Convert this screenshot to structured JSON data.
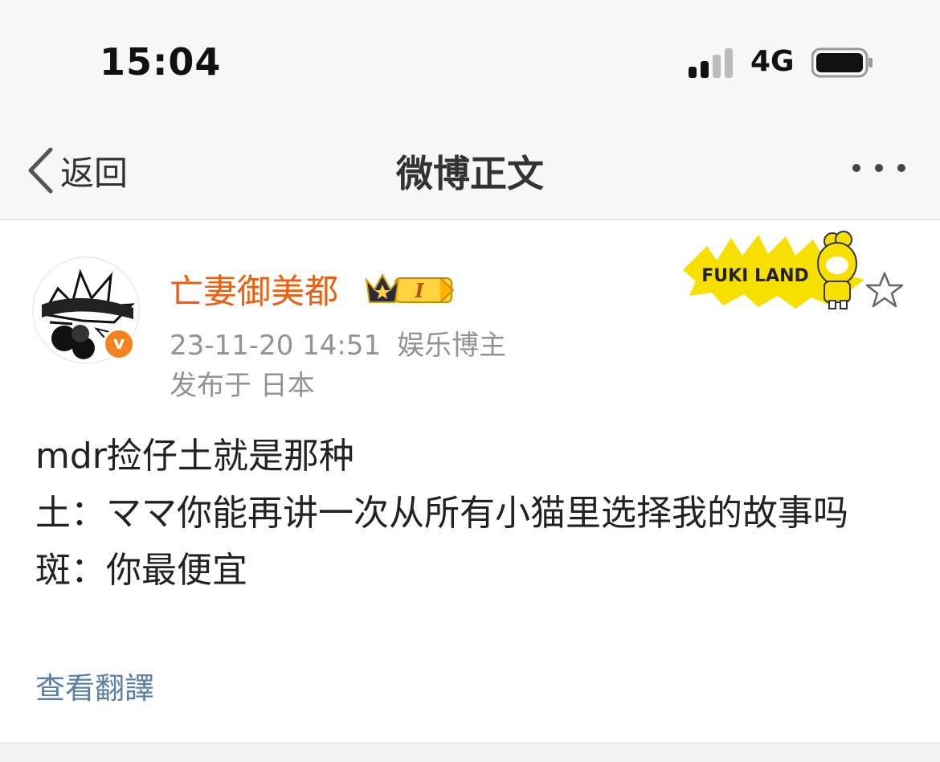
{
  "status_bar": {
    "time": "15:04",
    "network": "4G"
  },
  "nav": {
    "back_label": "返回",
    "title": "微博正文"
  },
  "post": {
    "username": "亡妻御美都",
    "badge_level": "I",
    "timestamp": "23-11-20 14:51",
    "user_label": "娱乐博主",
    "location": "发布于 日本",
    "banner_text": "FUKI LAND",
    "verified_mark": "v",
    "content_lines": [
      "mdr捡仔土就是那种",
      "土：ママ你能再讲一次从所有小猫里选择我的故事吗",
      "斑：你最便宜"
    ],
    "translate_label": "查看翻譯"
  },
  "colors": {
    "username": "#f05d0e",
    "link": "#5a7fa9",
    "meta": "#939393",
    "verified": "#f5821f",
    "banner_star": "#f7e000"
  }
}
